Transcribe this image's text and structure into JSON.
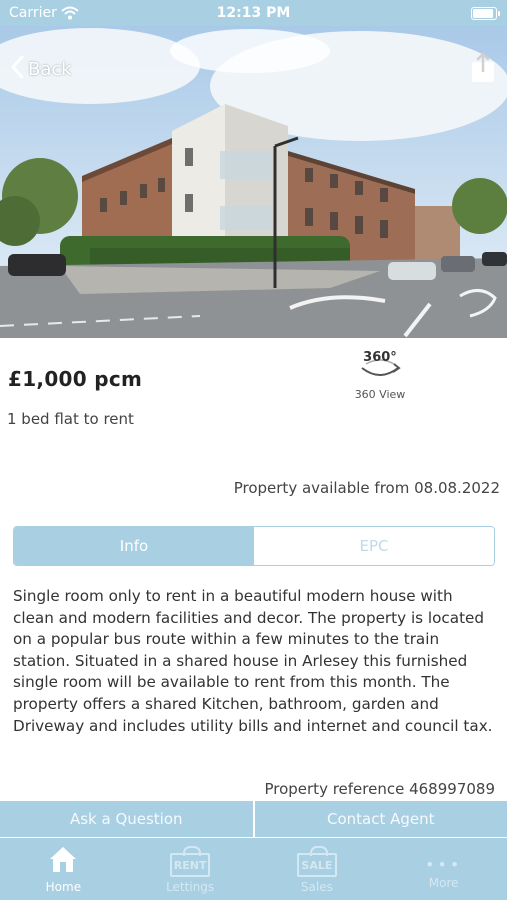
{
  "status_bar": {
    "carrier": "Carrier",
    "time": "12:13 PM"
  },
  "nav": {
    "back_label": "Back"
  },
  "listing": {
    "price": "£1,000 pcm",
    "subtitle": "1 bed flat to rent",
    "view360_icon_text": "360°",
    "view360_label": "360 View",
    "available": "Property available from 08.08.2022",
    "description": "Single room only to rent in a beautiful modern house with clean and modern facilities and decor. The property is located on a popular bus route within a few minutes to the train station. Situated in a shared house in Arlesey this furnished single room will be available to rent from this month. The property offers a shared Kitchen, bathroom, garden and Driveway and includes utility bills and internet and council tax.",
    "reference": "Property reference 468997089"
  },
  "tabs": [
    {
      "label": "Info",
      "active": true
    },
    {
      "label": "EPC",
      "active": false
    }
  ],
  "actions": {
    "ask": "Ask a Question",
    "contact": "Contact Agent"
  },
  "tabbar": {
    "home": "Home",
    "lettings": "Lettings",
    "lettings_badge": "RENT",
    "sales": "Sales",
    "sales_badge": "SALE",
    "more": "More"
  },
  "colors": {
    "accent": "#a9cfe3",
    "tab_inactive_text": "#bcdcec",
    "tabbar_inactive": "#d4e8f2"
  },
  "icons": {
    "wifi": "wifi-icon",
    "battery": "battery-icon",
    "back": "chevron-left-icon",
    "share": "share-icon",
    "view360": "rotate-360-icon",
    "home": "house-icon",
    "lettings": "rent-sign-icon",
    "sales": "sale-sign-icon",
    "more": "ellipsis-icon"
  }
}
